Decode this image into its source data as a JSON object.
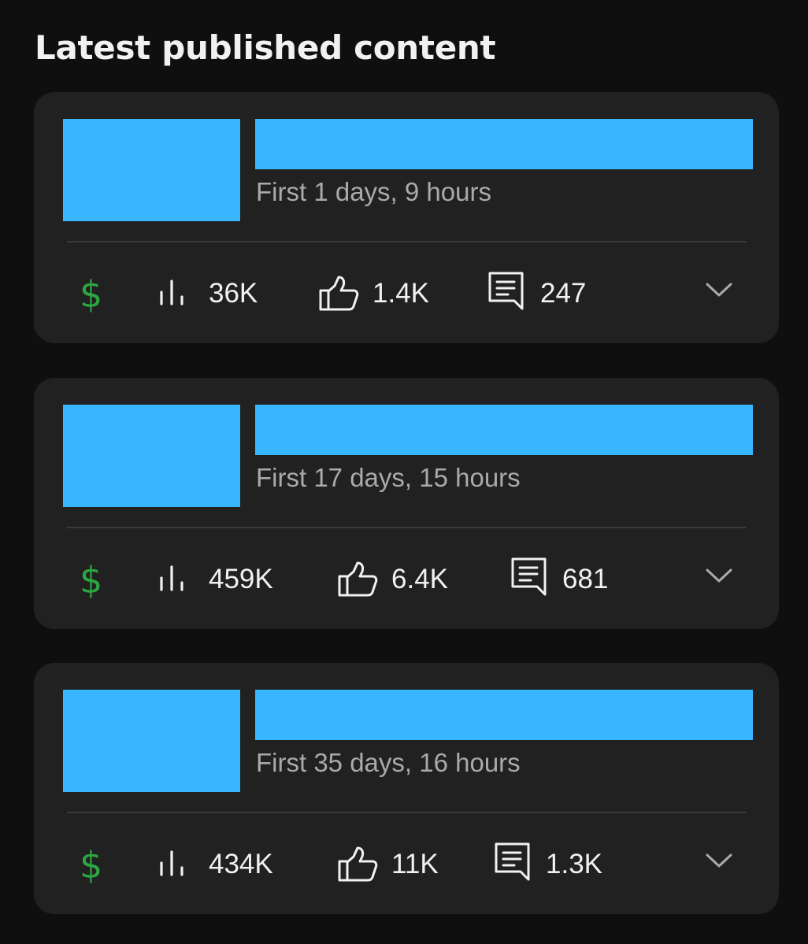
{
  "section": {
    "title": "Latest published content"
  },
  "colors": {
    "background": "#0f0f0f",
    "card": "#212121",
    "placeholder": "#38b6ff",
    "revenue_icon": "#2ba640",
    "subtitle": "#aaaaaa",
    "text": "#f1f1f1"
  },
  "icons": {
    "revenue": "dollar-sign",
    "views": "bar-chart-icon",
    "likes": "thumbs-up-icon",
    "comments": "comment-icon",
    "expand": "chevron-down-icon"
  },
  "items": [
    {
      "subtitle": "First 1 days, 9 hours",
      "revenue_symbol": "$",
      "views": "36K",
      "likes": "1.4K",
      "comments": "247"
    },
    {
      "subtitle": "First 17 days, 15 hours",
      "revenue_symbol": "$",
      "views": "459K",
      "likes": "6.4K",
      "comments": "681"
    },
    {
      "subtitle": "First 35 days, 16 hours",
      "revenue_symbol": "$",
      "views": "434K",
      "likes": "11K",
      "comments": "1.3K"
    }
  ]
}
